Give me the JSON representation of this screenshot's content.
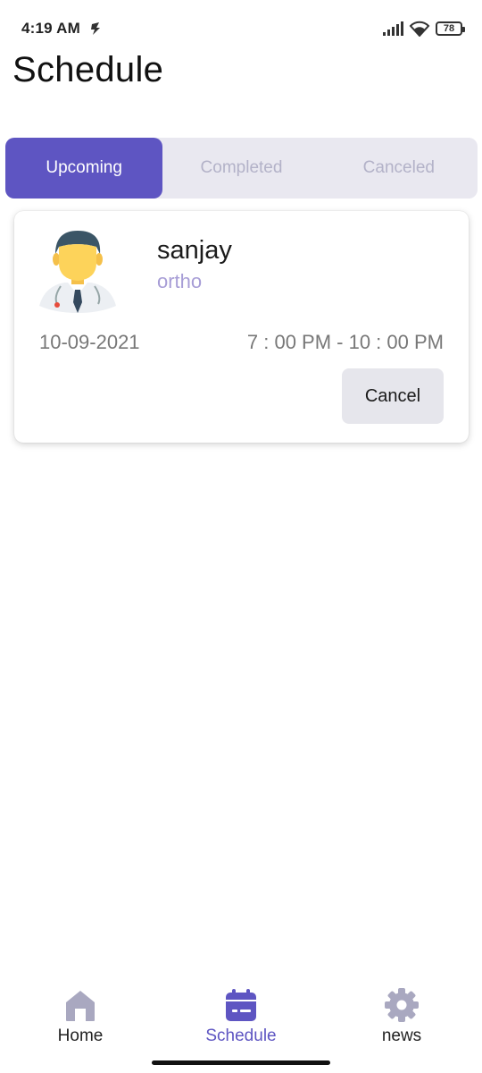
{
  "status_bar": {
    "time": "4:19 AM",
    "battery": "78"
  },
  "page": {
    "title": "Schedule"
  },
  "tabs": [
    {
      "label": "Upcoming",
      "active": true
    },
    {
      "label": "Completed",
      "active": false
    },
    {
      "label": "Canceled",
      "active": false
    }
  ],
  "appointment": {
    "doctor_name": "sanjay",
    "specialty": "ortho",
    "date": "10-09-2021",
    "time": "7 : 00 PM - 10 : 00 PM",
    "cancel_label": "Cancel"
  },
  "bottom_nav": [
    {
      "label": "Home",
      "icon": "home-icon",
      "active": false
    },
    {
      "label": "Schedule",
      "icon": "calendar-icon",
      "active": true
    },
    {
      "label": "news",
      "icon": "gear-icon",
      "active": false
    }
  ],
  "colors": {
    "accent": "#5e55c2",
    "tab_background": "#e9e8f0",
    "inactive_tab_text": "#b3b2c8",
    "specialty_text": "#a79dd6",
    "nav_icon_inactive": "#a9a8c0"
  }
}
